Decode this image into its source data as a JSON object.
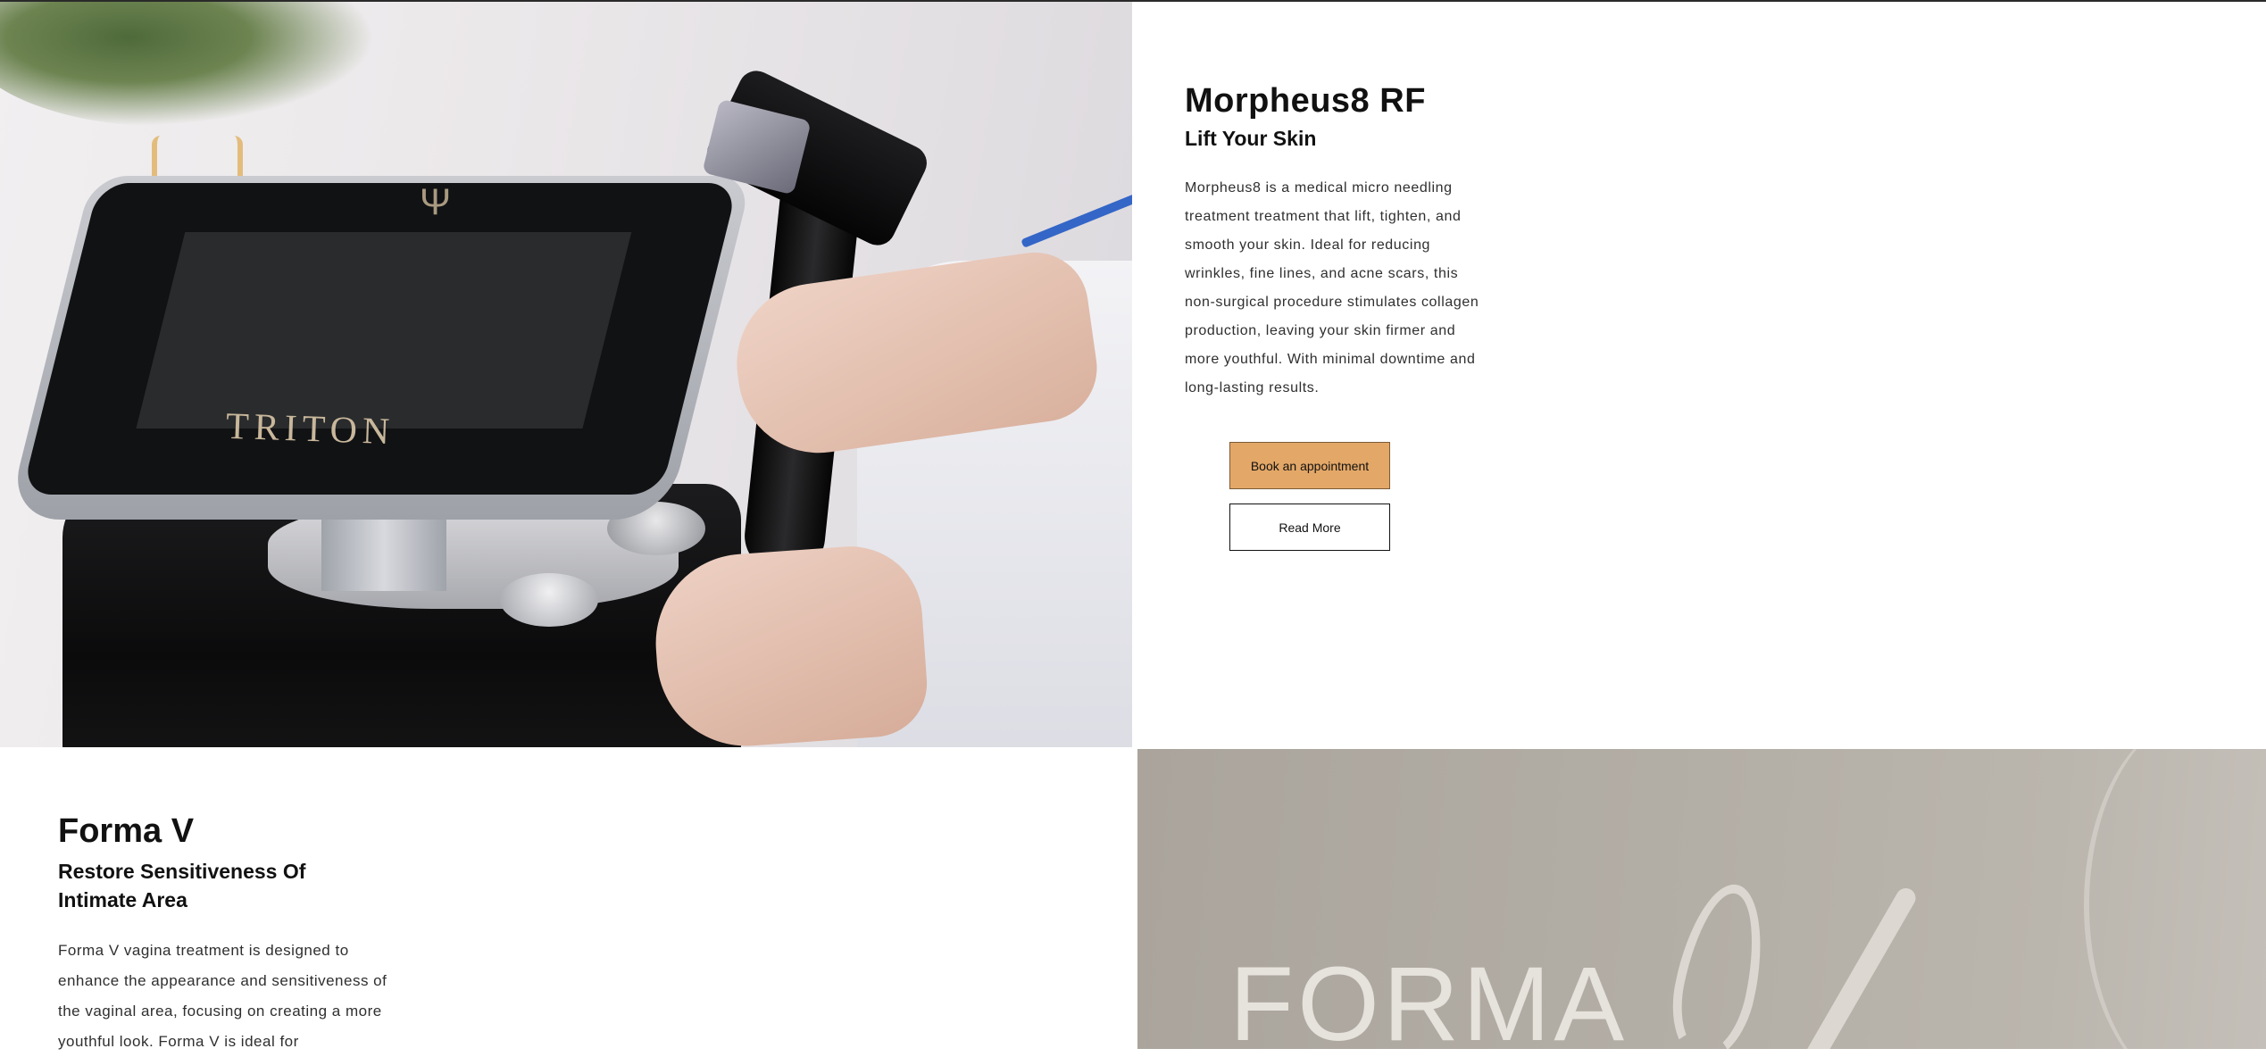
{
  "morpheus": {
    "image_alt": "TRITON",
    "title": "Morpheus8 RF",
    "subtitle": "Lift Your Skin",
    "description": "Morpheus8 is a medical micro needling treatment treatment that lift, tighten, and smooth your skin. Ideal for reducing wrinkles, fine lines, and acne scars, this non-surgical procedure stimulates collagen production, leaving your skin firmer and more youthful. With minimal downtime and long-lasting results.",
    "book_label": "Book an appointment",
    "read_label": "Read More"
  },
  "forma": {
    "title": "Forma V",
    "subtitle": "Restore Sensitiveness Of Intimate Area",
    "description": "Forma V vagina treatment is designed to enhance the appearance and sensitiveness of the vaginal area, focusing on creating a more youthful look. Forma V is ideal for",
    "image_word": "FORMA"
  },
  "colors": {
    "button_accent": "#e3a767",
    "text": "#111111",
    "body_text": "#2f2f2f"
  }
}
